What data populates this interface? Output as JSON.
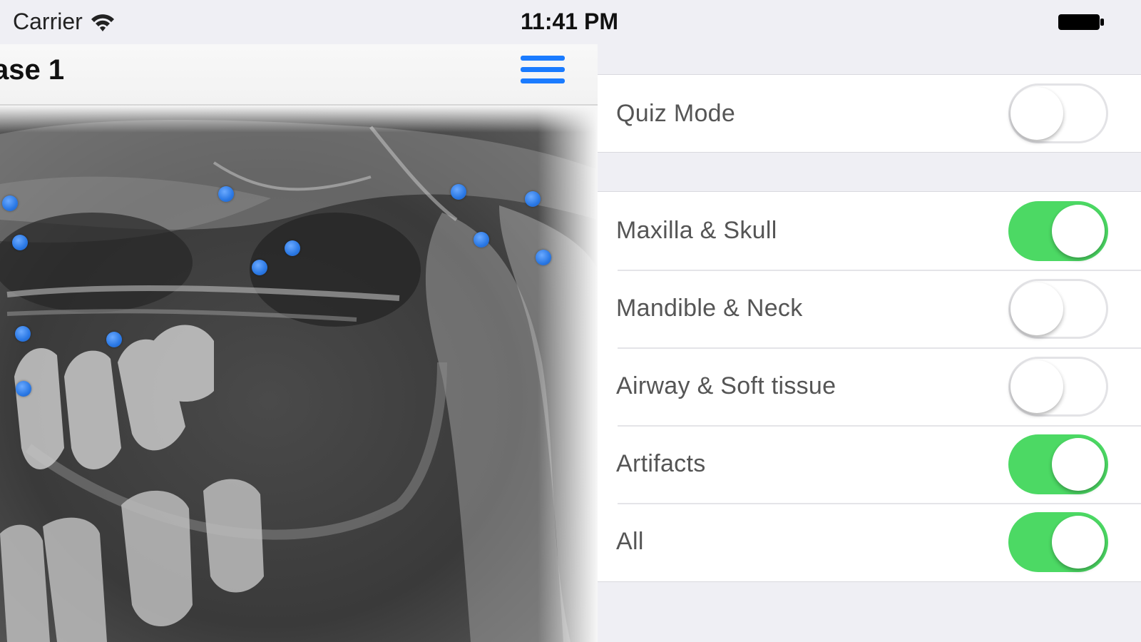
{
  "status_bar": {
    "carrier": "Carrier",
    "time": "11:41 PM"
  },
  "nav": {
    "title": "ase 1"
  },
  "settings": {
    "quiz": {
      "label": "Quiz Mode",
      "on": false
    },
    "layers": [
      {
        "label": "Maxilla & Skull",
        "on": true
      },
      {
        "label": "Mandible & Neck",
        "on": false
      },
      {
        "label": "Airway & Soft tissue",
        "on": false
      },
      {
        "label": "Artifacts",
        "on": true
      },
      {
        "label": "All",
        "on": true
      }
    ]
  },
  "colors": {
    "accent": "#1a7bff",
    "switch_on": "#4cd964",
    "landmark": "#2a78e4"
  }
}
